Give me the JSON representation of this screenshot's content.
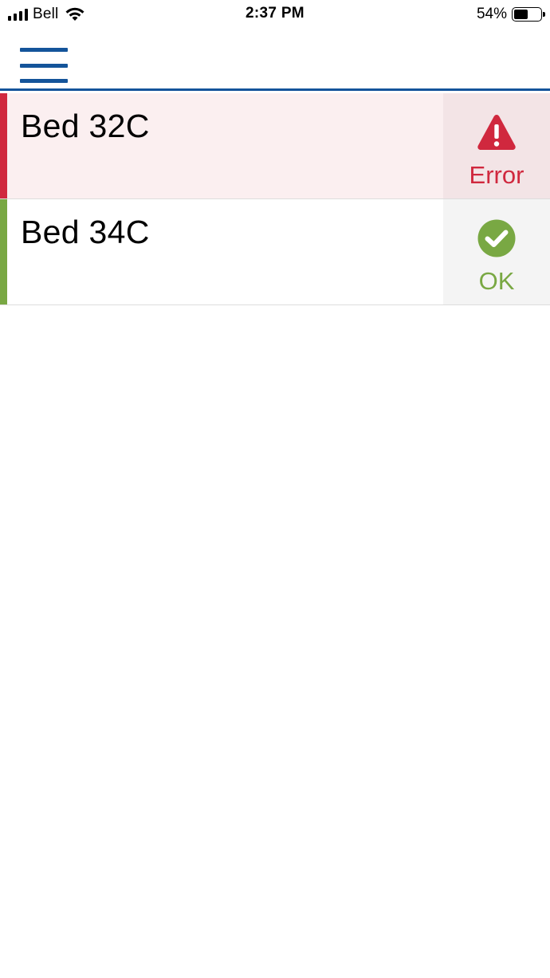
{
  "status_bar": {
    "carrier": "Bell",
    "time": "2:37 PM",
    "battery_percent": "54%",
    "battery_level": 0.54
  },
  "header": {
    "menu_icon": "hamburger-menu-icon",
    "accent_color": "#14549a"
  },
  "beds": [
    {
      "name": "Bed 32C",
      "status": "Error",
      "status_icon": "warning-triangle-icon",
      "status_color": "#d0283e"
    },
    {
      "name": "Bed 34C",
      "status": "OK",
      "status_icon": "check-circle-icon",
      "status_color": "#79a843"
    }
  ]
}
